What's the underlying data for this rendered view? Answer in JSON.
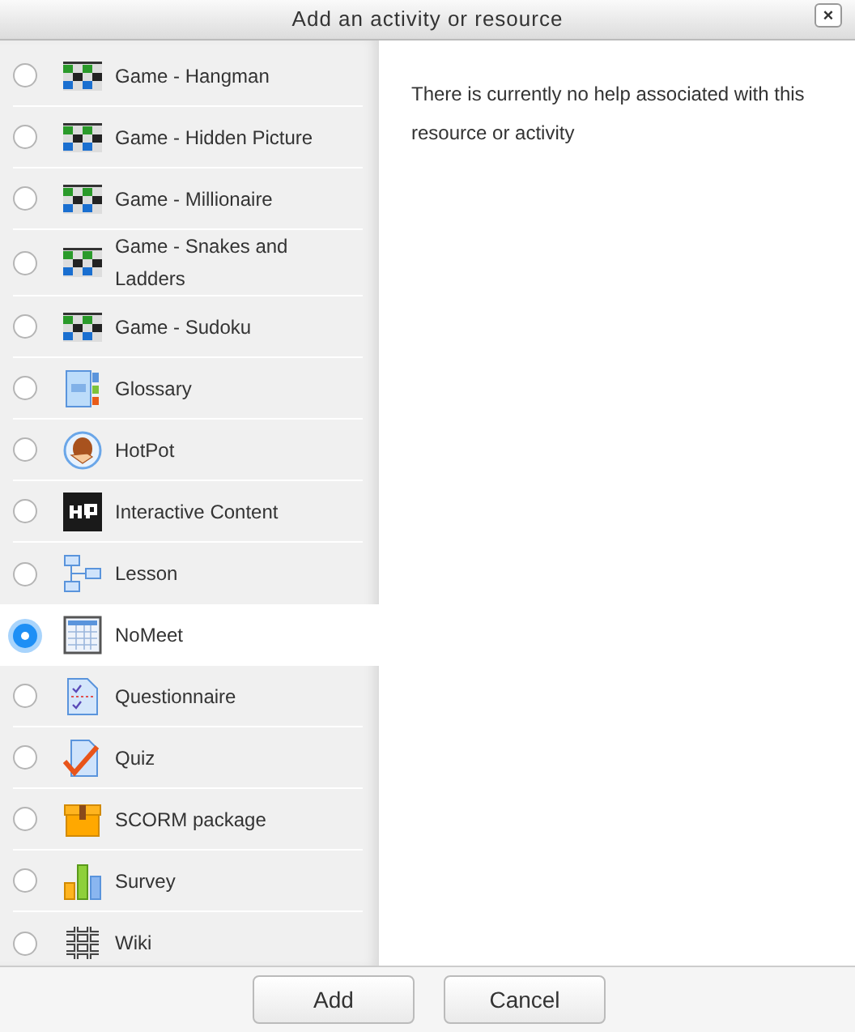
{
  "dialog": {
    "title": "Add an activity or resource",
    "close_label": "×"
  },
  "items": [
    {
      "label": "Game - Hangman",
      "kind": "game",
      "selected": false
    },
    {
      "label": "Game - Hidden Picture",
      "kind": "game",
      "selected": false
    },
    {
      "label": "Game - Millionaire",
      "kind": "game",
      "selected": false
    },
    {
      "label": "Game - Snakes and Ladders",
      "kind": "game",
      "selected": false
    },
    {
      "label": "Game - Sudoku",
      "kind": "game",
      "selected": false
    },
    {
      "label": "Glossary",
      "kind": "glossary",
      "selected": false
    },
    {
      "label": "HotPot",
      "kind": "hotpot",
      "selected": false
    },
    {
      "label": "Interactive Content",
      "kind": "h5p",
      "selected": false
    },
    {
      "label": "Lesson",
      "kind": "lesson",
      "selected": false
    },
    {
      "label": "NoMeet",
      "kind": "nomeet",
      "selected": true
    },
    {
      "label": "Questionnaire",
      "kind": "questionnaire",
      "selected": false
    },
    {
      "label": "Quiz",
      "kind": "quiz",
      "selected": false
    },
    {
      "label": "SCORM package",
      "kind": "scorm",
      "selected": false
    },
    {
      "label": "Survey",
      "kind": "survey",
      "selected": false
    },
    {
      "label": "Wiki",
      "kind": "wiki",
      "selected": false
    }
  ],
  "help_text": "There is currently no help associated with this resource or activity",
  "buttons": [
    "Add",
    "Cancel"
  ]
}
